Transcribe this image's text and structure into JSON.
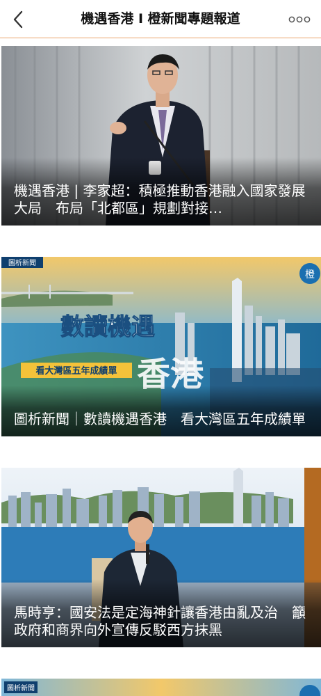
{
  "header": {
    "title": "機遇香港 I 橙新聞專題報道",
    "back_icon": "chevron-left-icon",
    "more_icon": "more-dots-icon"
  },
  "cards": [
    {
      "title": "機遇香港 | 李家超：積極推動香港融入國家發展大局　布局「北都區」規劃對接…"
    },
    {
      "tag": "圖析新聞",
      "overlay_main": "數讀機遇香港",
      "overlay_sub": "看大灣區五年成績單",
      "title": "圖析新聞｜數讀機遇香港　看大灣區五年成績單"
    },
    {
      "title": "馬時亨：國安法是定海神針讓香港由亂及治　籲政府和商界向外宣傳反駁西方抹黑"
    },
    {
      "tag": "圖析新聞"
    }
  ],
  "colors": {
    "accent": "#e9a36a",
    "caption_text": "#ffffff"
  }
}
